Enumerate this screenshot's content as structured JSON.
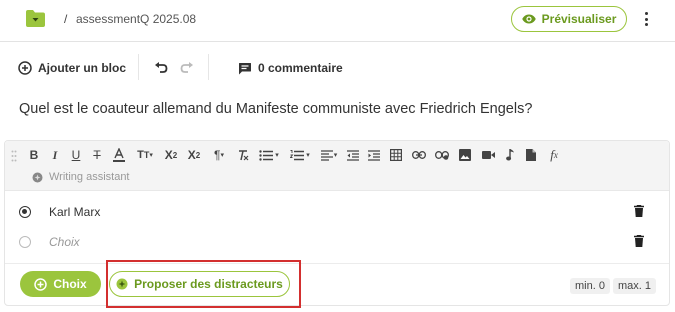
{
  "header": {
    "folder_icon": "folder-icon",
    "breadcrumb_separator": "/",
    "title": "assessmentQ 2025.08",
    "preview_label": "Prévisualiser",
    "accent_color": "#9bc53d"
  },
  "actions": {
    "add_block_label": "Ajouter un bloc",
    "comment_label": "0 commentaire"
  },
  "question": {
    "text": "Quel est le coauteur allemand du Manifeste communiste avec Friedrich Engels?"
  },
  "editor": {
    "writing_assistant_label": "Writing assistant",
    "toolbar_icons": [
      "bold-icon",
      "italic-icon",
      "underline-icon",
      "strikethrough-icon",
      "text-color-icon",
      "font-size-icon",
      "subscript-icon",
      "superscript-icon",
      "paragraph-icon",
      "clear-format-icon",
      "bullet-list-icon",
      "numbered-list-icon",
      "align-icon",
      "outdent-icon",
      "indent-icon",
      "table-icon",
      "link-icon",
      "unlink-icon",
      "image-icon",
      "video-icon",
      "audio-icon",
      "file-icon",
      "formula-icon"
    ]
  },
  "choices": [
    {
      "label": "Karl Marx",
      "selected": true
    },
    {
      "label": "Choix",
      "placeholder": true,
      "selected": false
    }
  ],
  "footer": {
    "add_choice_label": "Choix",
    "distractors_label": "Proposer des distracteurs",
    "min_label": "min. 0",
    "max_label": "max. 1",
    "highlight_color": "#d32f2f"
  }
}
